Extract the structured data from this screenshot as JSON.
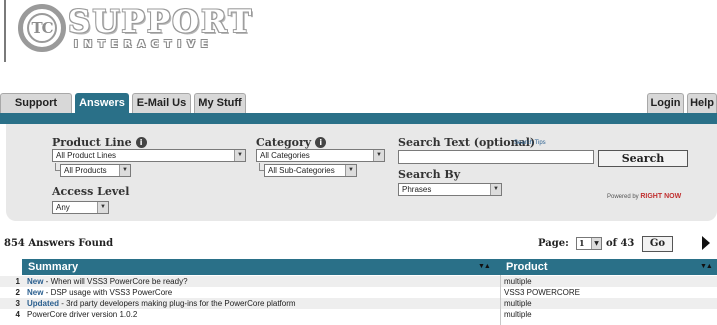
{
  "logo": {
    "mark": "TC",
    "wordmark": "SUPPORT",
    "tagline": "INTERACTIVE"
  },
  "tabs": [
    {
      "label": "Support Home",
      "active": false
    },
    {
      "label": "Answers",
      "active": true
    },
    {
      "label": "E-Mail Us",
      "active": false
    },
    {
      "label": "My Stuff",
      "active": false
    },
    {
      "label": "Login",
      "active": false
    },
    {
      "label": "Help",
      "active": false
    }
  ],
  "search": {
    "product_line_label": "Product Line",
    "product_line_value": "All Product Lines",
    "products_value": "All Products",
    "access_level_label": "Access Level",
    "access_level_value": "Any",
    "category_label": "Category",
    "category_value": "All Categories",
    "sub_category_value": "All Sub-Categories",
    "search_text_label": "Search Text (optional)",
    "search_text_value": "",
    "search_tips": "Search Tips",
    "search_by_label": "Search By",
    "search_by_value": "Phrases",
    "search_button": "Search",
    "powered_by": "Powered by",
    "powered_brand": "RIGHT NOW"
  },
  "results": {
    "count_text": "854 Answers Found",
    "page_label": "Page:",
    "page_value": "1",
    "page_of": "of 43",
    "go_button": "Go",
    "columns": {
      "summary": "Summary",
      "product": "Product"
    },
    "rows": [
      {
        "num": "1",
        "status": "New",
        "title": "When will VSS3 PowerCore be ready?",
        "product": "multiple"
      },
      {
        "num": "2",
        "status": "New",
        "title": "DSP usage with VSS3 PowerCore",
        "product": "VSS3 POWERCORE"
      },
      {
        "num": "3",
        "status": "Updated",
        "title": "3rd party developers making plug-ins for the PowerCore platform",
        "product": "multiple"
      },
      {
        "num": "4",
        "status": "",
        "title": "PowerCore driver version 1.0.2",
        "product": "multiple"
      }
    ]
  },
  "colors": {
    "accent": "#2a7088",
    "panel": "#e8e8e8",
    "link": "#2a5f8f"
  },
  "icons": {
    "info": "info-icon",
    "next": "next-page-arrow-icon",
    "sort": "sort-arrows-icon",
    "dropdown": "dropdown-arrow-icon"
  }
}
